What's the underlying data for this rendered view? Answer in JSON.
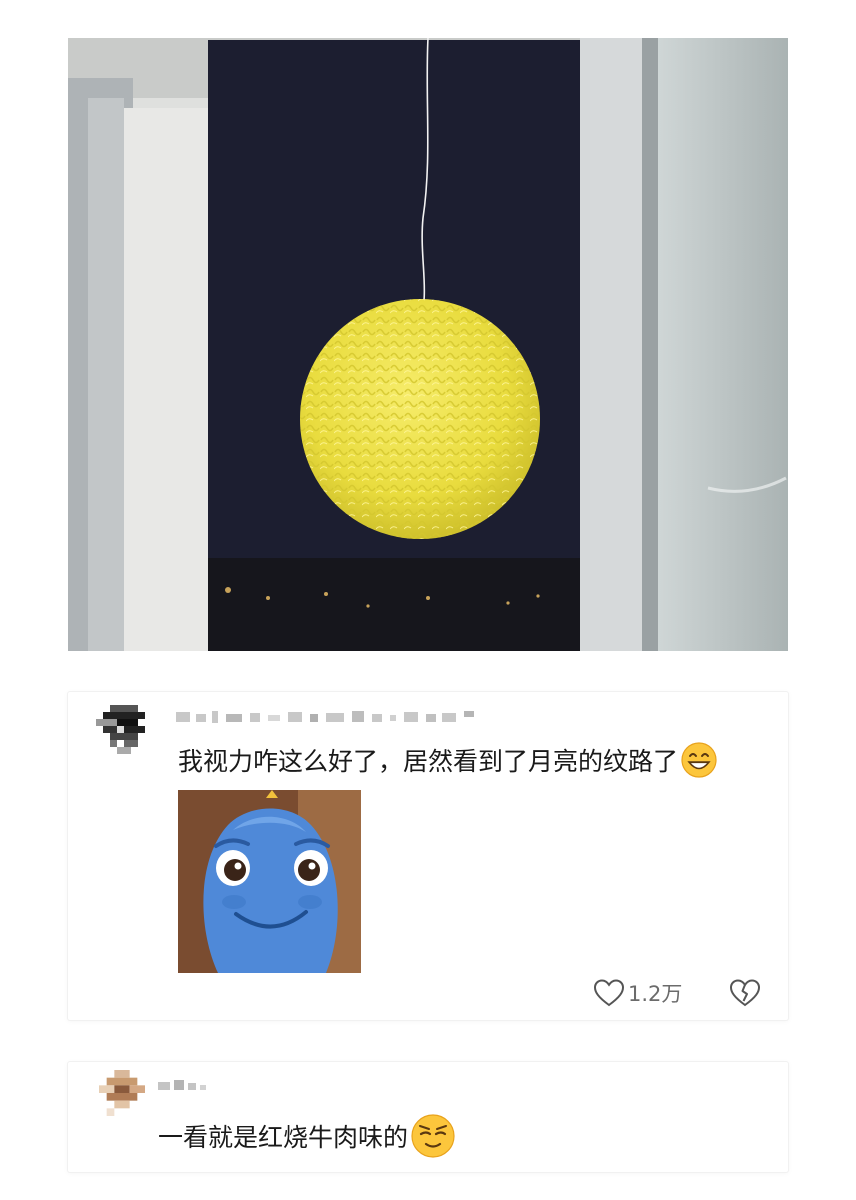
{
  "post": {
    "image": {
      "scene_colors": {
        "night_sky": "#1c1e30",
        "frame": "#cdd0d4",
        "wall": "#e5e5e3",
        "noodle_ball": "#f0e24a"
      }
    }
  },
  "comments": [
    {
      "text": "我视力咋这么好了，居然看到了月亮的纹路了",
      "emoji_icon": "grinning-face-icon",
      "has_sticker": true,
      "likes": "1.2万",
      "like_icon": "heart-outline-icon",
      "dislike_icon": "broken-heart-icon"
    },
    {
      "text": "一看就是红烧牛肉味的",
      "emoji_icon": "smirking-face-icon"
    }
  ],
  "colors": {
    "text": "#1a1a1a",
    "meta": "#6b6b6b",
    "card_border": "#f1f1f1"
  }
}
